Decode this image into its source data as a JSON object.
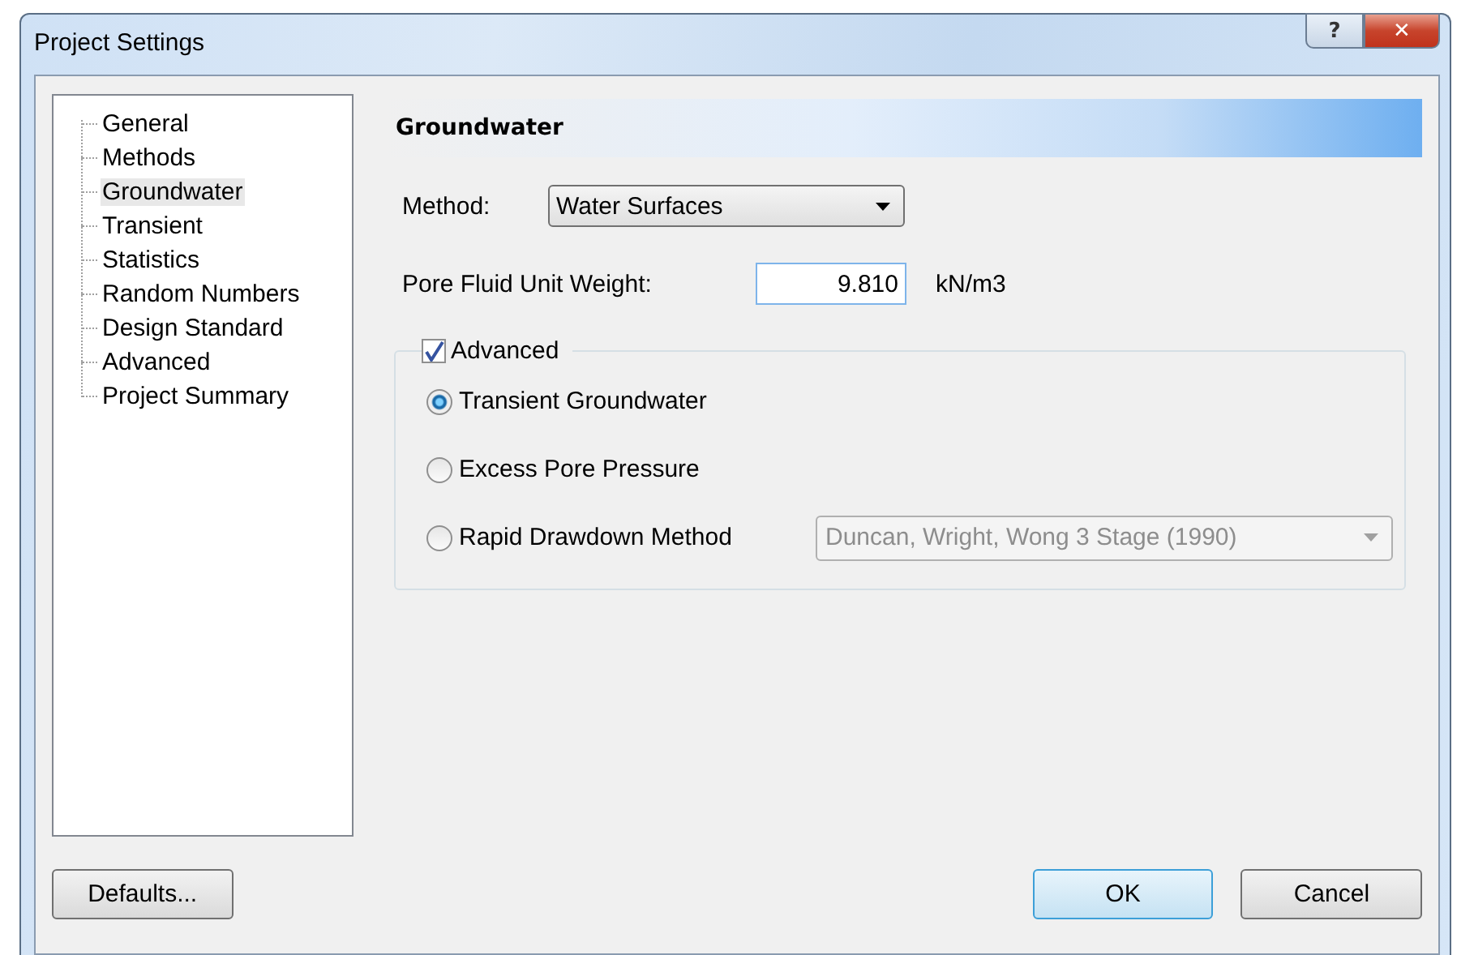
{
  "window": {
    "title": "Project Settings",
    "controls": [
      "?",
      "✕"
    ]
  },
  "sidebar": {
    "items": [
      {
        "label": "General",
        "selected": false
      },
      {
        "label": "Methods",
        "selected": false
      },
      {
        "label": "Groundwater",
        "selected": true
      },
      {
        "label": "Transient",
        "selected": false
      },
      {
        "label": "Statistics",
        "selected": false
      },
      {
        "label": "Random Numbers",
        "selected": false
      },
      {
        "label": "Design Standard",
        "selected": false
      },
      {
        "label": "Advanced",
        "selected": false
      },
      {
        "label": "Project Summary",
        "selected": false
      }
    ]
  },
  "panel": {
    "heading": "Groundwater",
    "method": {
      "label": "Method:",
      "value": "Water Surfaces"
    },
    "unit_weight": {
      "label": "Pore Fluid Unit Weight:",
      "value": "9.810",
      "unit": "kN/m3"
    },
    "advanced": {
      "label": "Advanced",
      "checked": true,
      "options": [
        {
          "label": "Transient Groundwater",
          "selected": true
        },
        {
          "label": "Excess Pore Pressure",
          "selected": false
        },
        {
          "label": "Rapid Drawdown Method",
          "selected": false,
          "select": {
            "value": "Duncan, Wright, Wong 3 Stage (1990)",
            "disabled": true
          }
        }
      ]
    }
  },
  "buttons": {
    "defaults": "Defaults...",
    "ok": "OK",
    "cancel": "Cancel"
  }
}
